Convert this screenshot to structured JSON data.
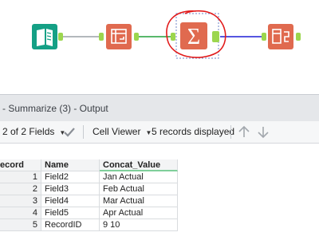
{
  "canvas": {
    "tools": [
      {
        "name": "input-tool",
        "color": "#14a085"
      },
      {
        "name": "crosstab-tool",
        "color": "#e06a4f"
      },
      {
        "name": "summarize-tool",
        "color": "#e06a4f",
        "selected": true,
        "glyph": "Σ"
      },
      {
        "name": "output-tool",
        "color": "#e06a4f"
      }
    ],
    "connector_colors": [
      "#9aa0a6",
      "#22a03a",
      "#1f1fd6"
    ],
    "anchor_color": "#9cd64e",
    "highlight_color": "#e21b1b"
  },
  "panel": {
    "title": "- Summarize (3) - Output"
  },
  "toolbar": {
    "fields_label": "2 of 2 Fields",
    "viewer_label": "Cell Viewer",
    "records_label": "5 records displayed"
  },
  "table": {
    "columns": [
      "ecord",
      "Name",
      "Concat_Value"
    ],
    "rows": [
      {
        "n": "1",
        "name": "Field2",
        "value": "Jan Actual"
      },
      {
        "n": "2",
        "name": "Field3",
        "value": "Feb Actual"
      },
      {
        "n": "3",
        "name": "Field4",
        "value": "Mar Actual"
      },
      {
        "n": "4",
        "name": "Field5",
        "value": "Apr Actual"
      },
      {
        "n": "5",
        "name": "RecordID",
        "value": "9 10"
      }
    ]
  }
}
